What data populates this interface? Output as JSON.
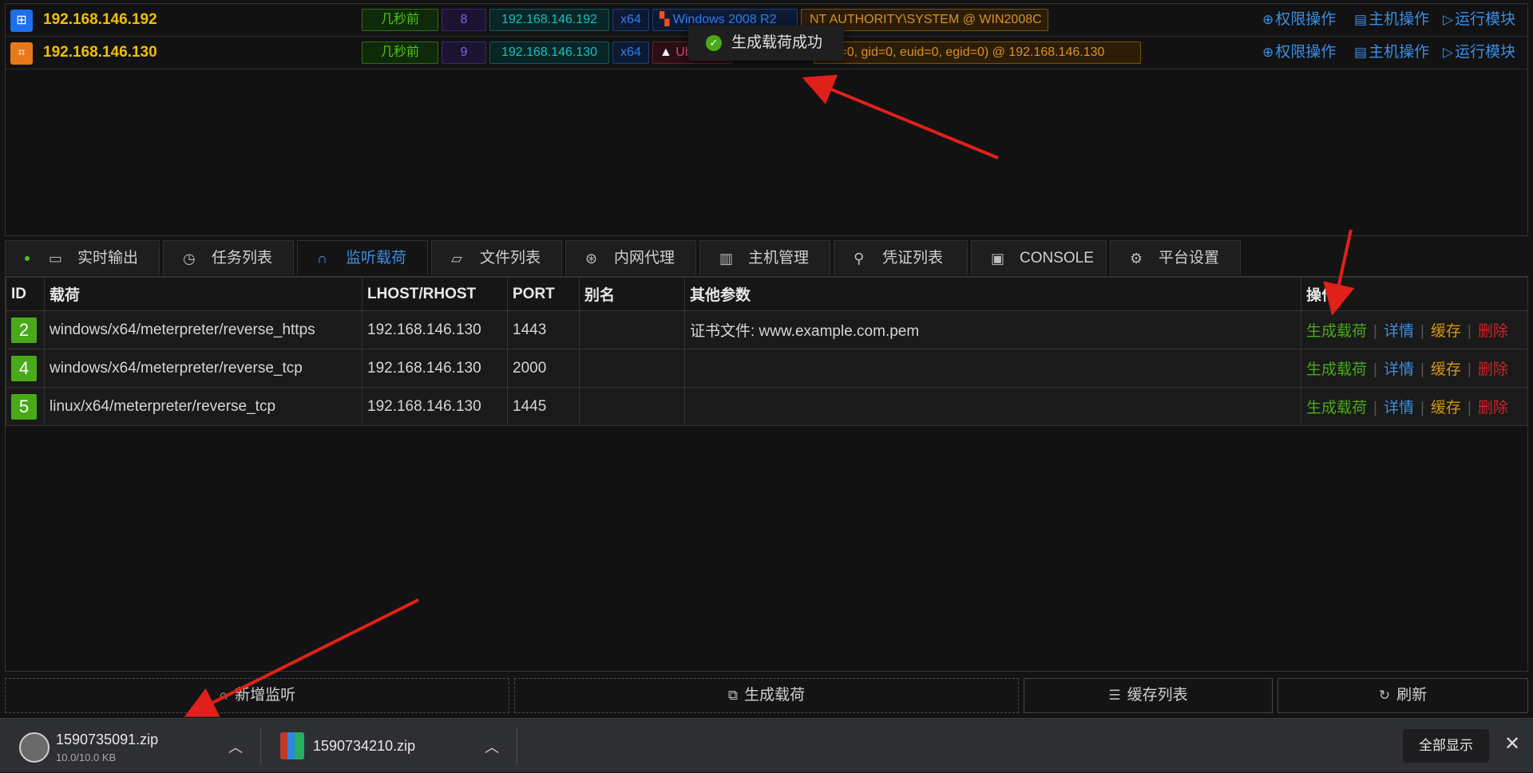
{
  "hosts": [
    {
      "ip": "192.168.146.192",
      "time": "几秒前",
      "session": "8",
      "ip_tag": "192.168.146.192",
      "arch": "x64",
      "os": "Windows 2008 R2",
      "user": "NT AUTHORITY\\SYSTEM @ WIN2008C",
      "ops": [
        "权限操作",
        "主机操作",
        "运行模块"
      ]
    },
    {
      "ip": "192.168.146.130",
      "time": "几秒前",
      "session": "9",
      "ip_tag": "192.168.146.130",
      "arch": "x64",
      "os": "Ubuntu",
      "user": "uid=0, gid=0, euid=0, egid=0) @ 192.168.146.130",
      "ops": [
        "权限操作",
        "主机操作",
        "运行模块"
      ]
    }
  ],
  "toast": {
    "message": "生成载荷成功"
  },
  "tabs": [
    "实时输出",
    "任务列表",
    "监听载荷",
    "文件列表",
    "内网代理",
    "主机管理",
    "凭证列表",
    "CONSOLE",
    "平台设置"
  ],
  "table": {
    "headers": [
      "ID",
      "载荷",
      "LHOST/RHOST",
      "PORT",
      "别名",
      "其他参数",
      "操作"
    ],
    "rows": [
      {
        "id": "2",
        "payload": "windows/x64/meterpreter/reverse_https",
        "host": "192.168.146.130",
        "port": "1443",
        "alias": "",
        "params": "证书文件: www.example.com.pem"
      },
      {
        "id": "4",
        "payload": "windows/x64/meterpreter/reverse_tcp",
        "host": "192.168.146.130",
        "port": "2000",
        "alias": "",
        "params": ""
      },
      {
        "id": "5",
        "payload": "linux/x64/meterpreter/reverse_tcp",
        "host": "192.168.146.130",
        "port": "1445",
        "alias": "",
        "params": ""
      }
    ],
    "actions": {
      "generate": "生成载荷",
      "detail": "详情",
      "cache": "缓存",
      "delete": "删除",
      "separator": "|"
    }
  },
  "buttons": {
    "add_listener": "新增监听",
    "generate_payload": "生成载荷",
    "cache_list": "缓存列表",
    "refresh": "刷新"
  },
  "downloads": {
    "items": [
      {
        "name": "1590735091.zip",
        "size": "10.0/10.0 KB"
      },
      {
        "name": "1590734210.zip",
        "size": ""
      }
    ],
    "show_all": "全部显示",
    "close": "✕"
  },
  "colors": {
    "accent_blue": "#3a8ee6",
    "success_green": "#49aa19",
    "warning_orange": "#d89614",
    "danger_red": "#d32029",
    "host_ip_yellow": "#f0c000"
  }
}
